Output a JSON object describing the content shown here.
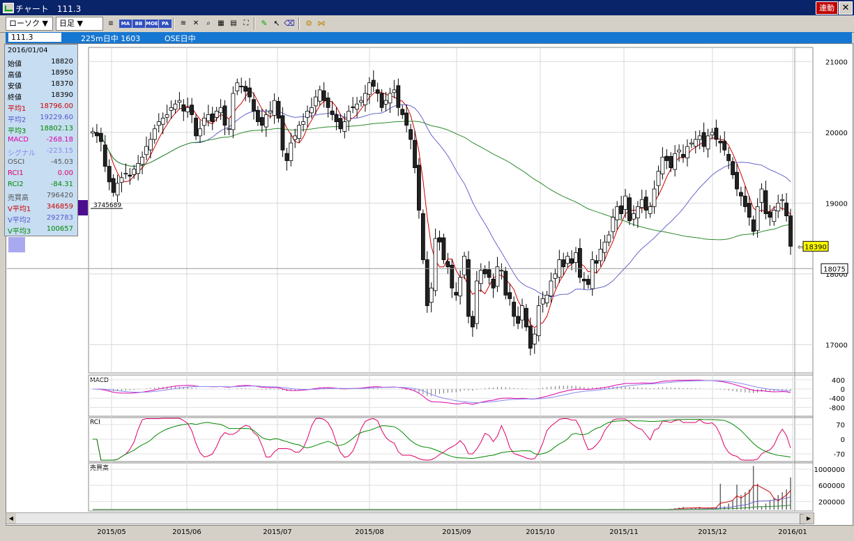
{
  "window": {
    "title": "チャート　111.3",
    "rendo_label": "連動",
    "close_label": "✕"
  },
  "toolbar": {
    "mode_dropdown": "ローソク ▼",
    "period_dropdown": "日足 ▼",
    "indicator_buttons": [
      "MA",
      "BB",
      "MOE",
      "PA"
    ]
  },
  "infobar": {
    "code": "111.3",
    "name": "225m日中 1603",
    "market": "OSE日中"
  },
  "ohlc": {
    "date": "2016/01/04",
    "rows": [
      {
        "k": "始値",
        "v": "18820",
        "c": "#000000"
      },
      {
        "k": "高値",
        "v": "18950",
        "c": "#000000"
      },
      {
        "k": "安値",
        "v": "18370",
        "c": "#000000"
      },
      {
        "k": "終値",
        "v": "18390",
        "c": "#000000"
      },
      {
        "k": "平均1",
        "v": "18796.00",
        "c": "#cc0000"
      },
      {
        "k": "平均2",
        "v": "19229.60",
        "c": "#5555cc"
      },
      {
        "k": "平均3",
        "v": "18802.13",
        "c": "#008800"
      },
      {
        "k": "MACD",
        "v": "-268.18",
        "c": "#dd00aa"
      },
      {
        "k": "シグナル",
        "v": "-223.15",
        "c": "#8888ee"
      },
      {
        "k": "OSCI",
        "v": "-45.03",
        "c": "#555555"
      },
      {
        "k": "RCI1",
        "v": "0.00",
        "c": "#dd0066"
      },
      {
        "k": "RCI2",
        "v": "-84.31",
        "c": "#008800"
      },
      {
        "k": "売買高",
        "v": "796420",
        "c": "#555555"
      },
      {
        "k": "V平均1",
        "v": "346859",
        "c": "#cc0000"
      },
      {
        "k": "V平均2",
        "v": "292783",
        "c": "#5555cc"
      },
      {
        "k": "V平均3",
        "v": "100657",
        "c": "#008800"
      }
    ]
  },
  "annotations": {
    "left_volume_label": "3745689",
    "last_price": "18390",
    "cursor_price": "18075"
  },
  "panel_titles": {
    "macd": "MACD",
    "rci": "RCI",
    "volume": "売買高"
  },
  "chart_data": {
    "type": "candlestick",
    "x_ticks": [
      "2015/05",
      "2015/06",
      "2015/07",
      "2015/08",
      "2015/09",
      "2015/10",
      "2015/11",
      "2015/12",
      "2016/01"
    ],
    "main_y_ticks": [
      "21000",
      "20000",
      "19000",
      "18000",
      "17000"
    ],
    "macd_y_ticks": [
      "400",
      "0",
      "-400",
      "-800"
    ],
    "rci_y_ticks": [
      "70",
      "0",
      "-70"
    ],
    "volume_y_ticks": [
      "1000000",
      "600000",
      "200000"
    ],
    "ylim": [
      16600,
      21200
    ],
    "colors": {
      "up": "#ffffff",
      "down": "#222222",
      "ma1": "#cc0000",
      "ma2": "#6666cc",
      "ma3": "#2a8a2a",
      "macd": "#dd00aa",
      "signal": "#8888ee",
      "rci1": "#dd0066",
      "rci2": "#008800"
    },
    "closes": [
      20010,
      19950,
      19870,
      19520,
      19300,
      19150,
      19280,
      19360,
      19420,
      19380,
      19480,
      19560,
      19650,
      19800,
      19900,
      20050,
      20150,
      20200,
      20250,
      20350,
      20400,
      20450,
      20300,
      20350,
      20250,
      19950,
      20050,
      20200,
      20250,
      20150,
      20300,
      20350,
      20100,
      20050,
      20550,
      20700,
      20650,
      20580,
      20500,
      20300,
      20150,
      20100,
      20250,
      20300,
      20450,
      20200,
      19750,
      19600,
      19850,
      19950,
      20100,
      20150,
      20300,
      20350,
      20500,
      20600,
      20450,
      20350,
      20250,
      20150,
      20050,
      20150,
      20300,
      20350,
      20400,
      20450,
      20550,
      20700,
      20650,
      20550,
      20350,
      20450,
      20550,
      20600,
      20350,
      20250,
      20100,
      19900,
      19500,
      18900,
      18200,
      17550,
      17800,
      18500,
      18450,
      18200,
      18100,
      17800,
      17700,
      17950,
      18250,
      17400,
      17250,
      17900,
      18050,
      18000,
      17950,
      17800,
      18100,
      18050,
      17700,
      17650,
      17400,
      17300,
      17550,
      17250,
      16950,
      17150,
      17550,
      17650,
      17700,
      17900,
      18000,
      18200,
      18100,
      18250,
      18150,
      18300,
      17950,
      17900,
      17850,
      18200,
      18150,
      18350,
      18450,
      18550,
      18800,
      18950,
      18850,
      19100,
      18750,
      18850,
      18950,
      19050,
      18900,
      18950,
      19200,
      19450,
      19650,
      19600,
      19500,
      19700,
      19750,
      19650,
      19800,
      19850,
      19900,
      19950,
      19800,
      19950,
      20000,
      19900,
      19850,
      19750,
      19600,
      19400,
      19200,
      19100,
      18950,
      18800,
      18600,
      18950,
      19200,
      18850,
      18800,
      18900,
      19000,
      19050,
      18820,
      18390
    ]
  }
}
